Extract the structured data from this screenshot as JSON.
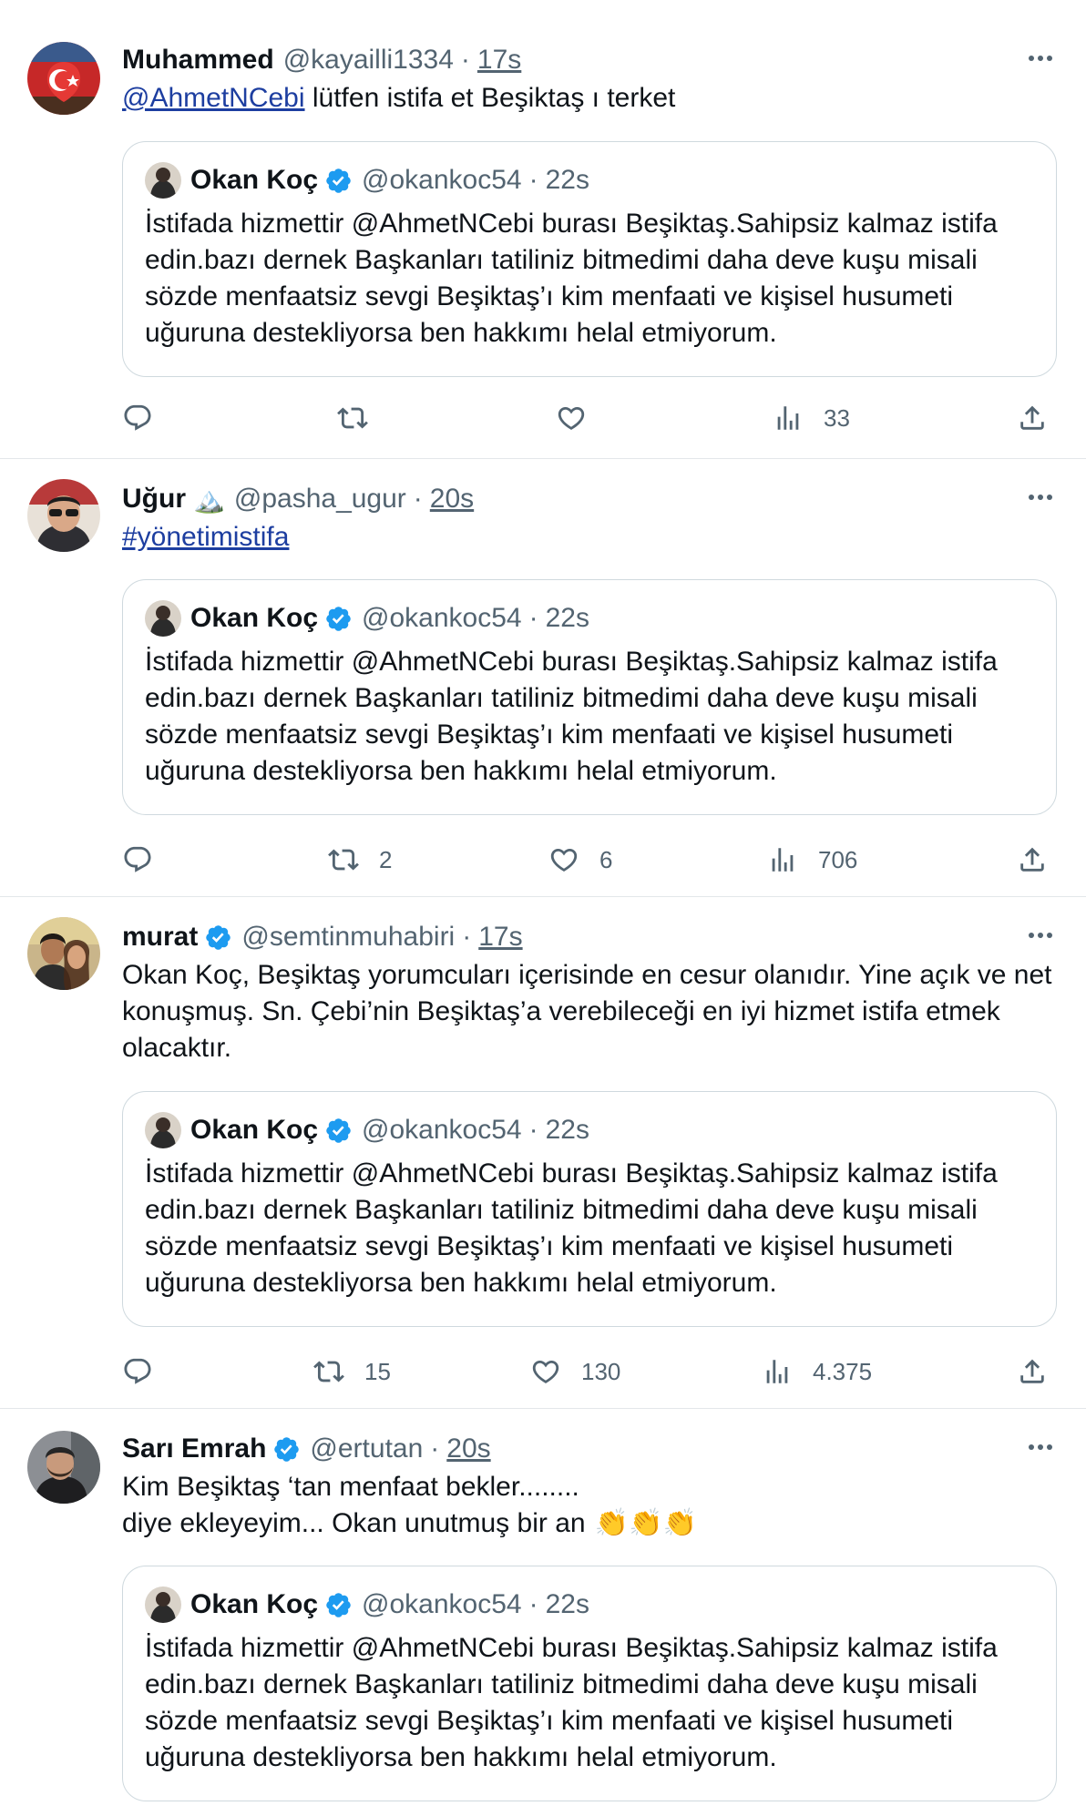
{
  "quoted_tweet": {
    "name": "Okan Koç",
    "handle": "@okankoc54",
    "time": "22s",
    "text": "İstifada hizmettir @AhmetNCebi burası Beşiktaş.Sahipsiz kalmaz istifa edin.bazı dernek Başkanları tatiliniz bitmedimi daha deve kuşu misali sözde menfaatsiz sevgi Beşiktaş’ı kim menfaati ve kişisel husumeti uğuruna destekliyorsa ben hakkımı helal etmiyorum.",
    "verified": true
  },
  "tweets": [
    {
      "name": "Muhammed",
      "handle": "@kayailli1334",
      "time": "17s",
      "mention": "@AhmetNCebi",
      "text_after_mention": " lütfen istifa et Beşiktaş ı terket",
      "actions": {
        "reply": "",
        "retweet": "",
        "like": "",
        "views": "33"
      }
    },
    {
      "name": "Uğur",
      "name_emoji": "🏔️",
      "handle": "@pasha_ugur",
      "time": "20s",
      "hashtag": "#yönetimistifa",
      "actions": {
        "reply": "",
        "retweet": "2",
        "like": "6",
        "views": "706"
      }
    },
    {
      "name": "murat",
      "verified": true,
      "handle": "@semtinmuhabiri",
      "time": "17s",
      "text": "Okan Koç, Beşiktaş yorumcuları içerisinde en cesur olanıdır. Yine açık ve net konuşmuş. Sn. Çebi’nin Beşiktaş’a verebileceği en iyi hizmet istifa etmek olacaktır.",
      "actions": {
        "reply": "",
        "retweet": "15",
        "like": "130",
        "views": "4.375"
      }
    },
    {
      "name": "Sarı Emrah",
      "verified": true,
      "handle": "@ertutan",
      "time": "20s",
      "text_line1": "Kim Beşiktaş ‘tan menfaat bekler........",
      "text_line2": "diye ekleyeyim... Okan unutmuş bir an ",
      "text_emoji": "👏👏👏"
    }
  ],
  "icons": {
    "reply": "reply-icon",
    "retweet": "retweet-icon",
    "like": "heart-icon",
    "views": "views-icon",
    "share": "share-icon",
    "more": "more-options-icon",
    "verified": "verified-badge-icon"
  },
  "colors": {
    "link": "#1d3ea0",
    "verified": "#1d9bf0",
    "secondary_text": "#536471",
    "border": "#cfd9de"
  }
}
